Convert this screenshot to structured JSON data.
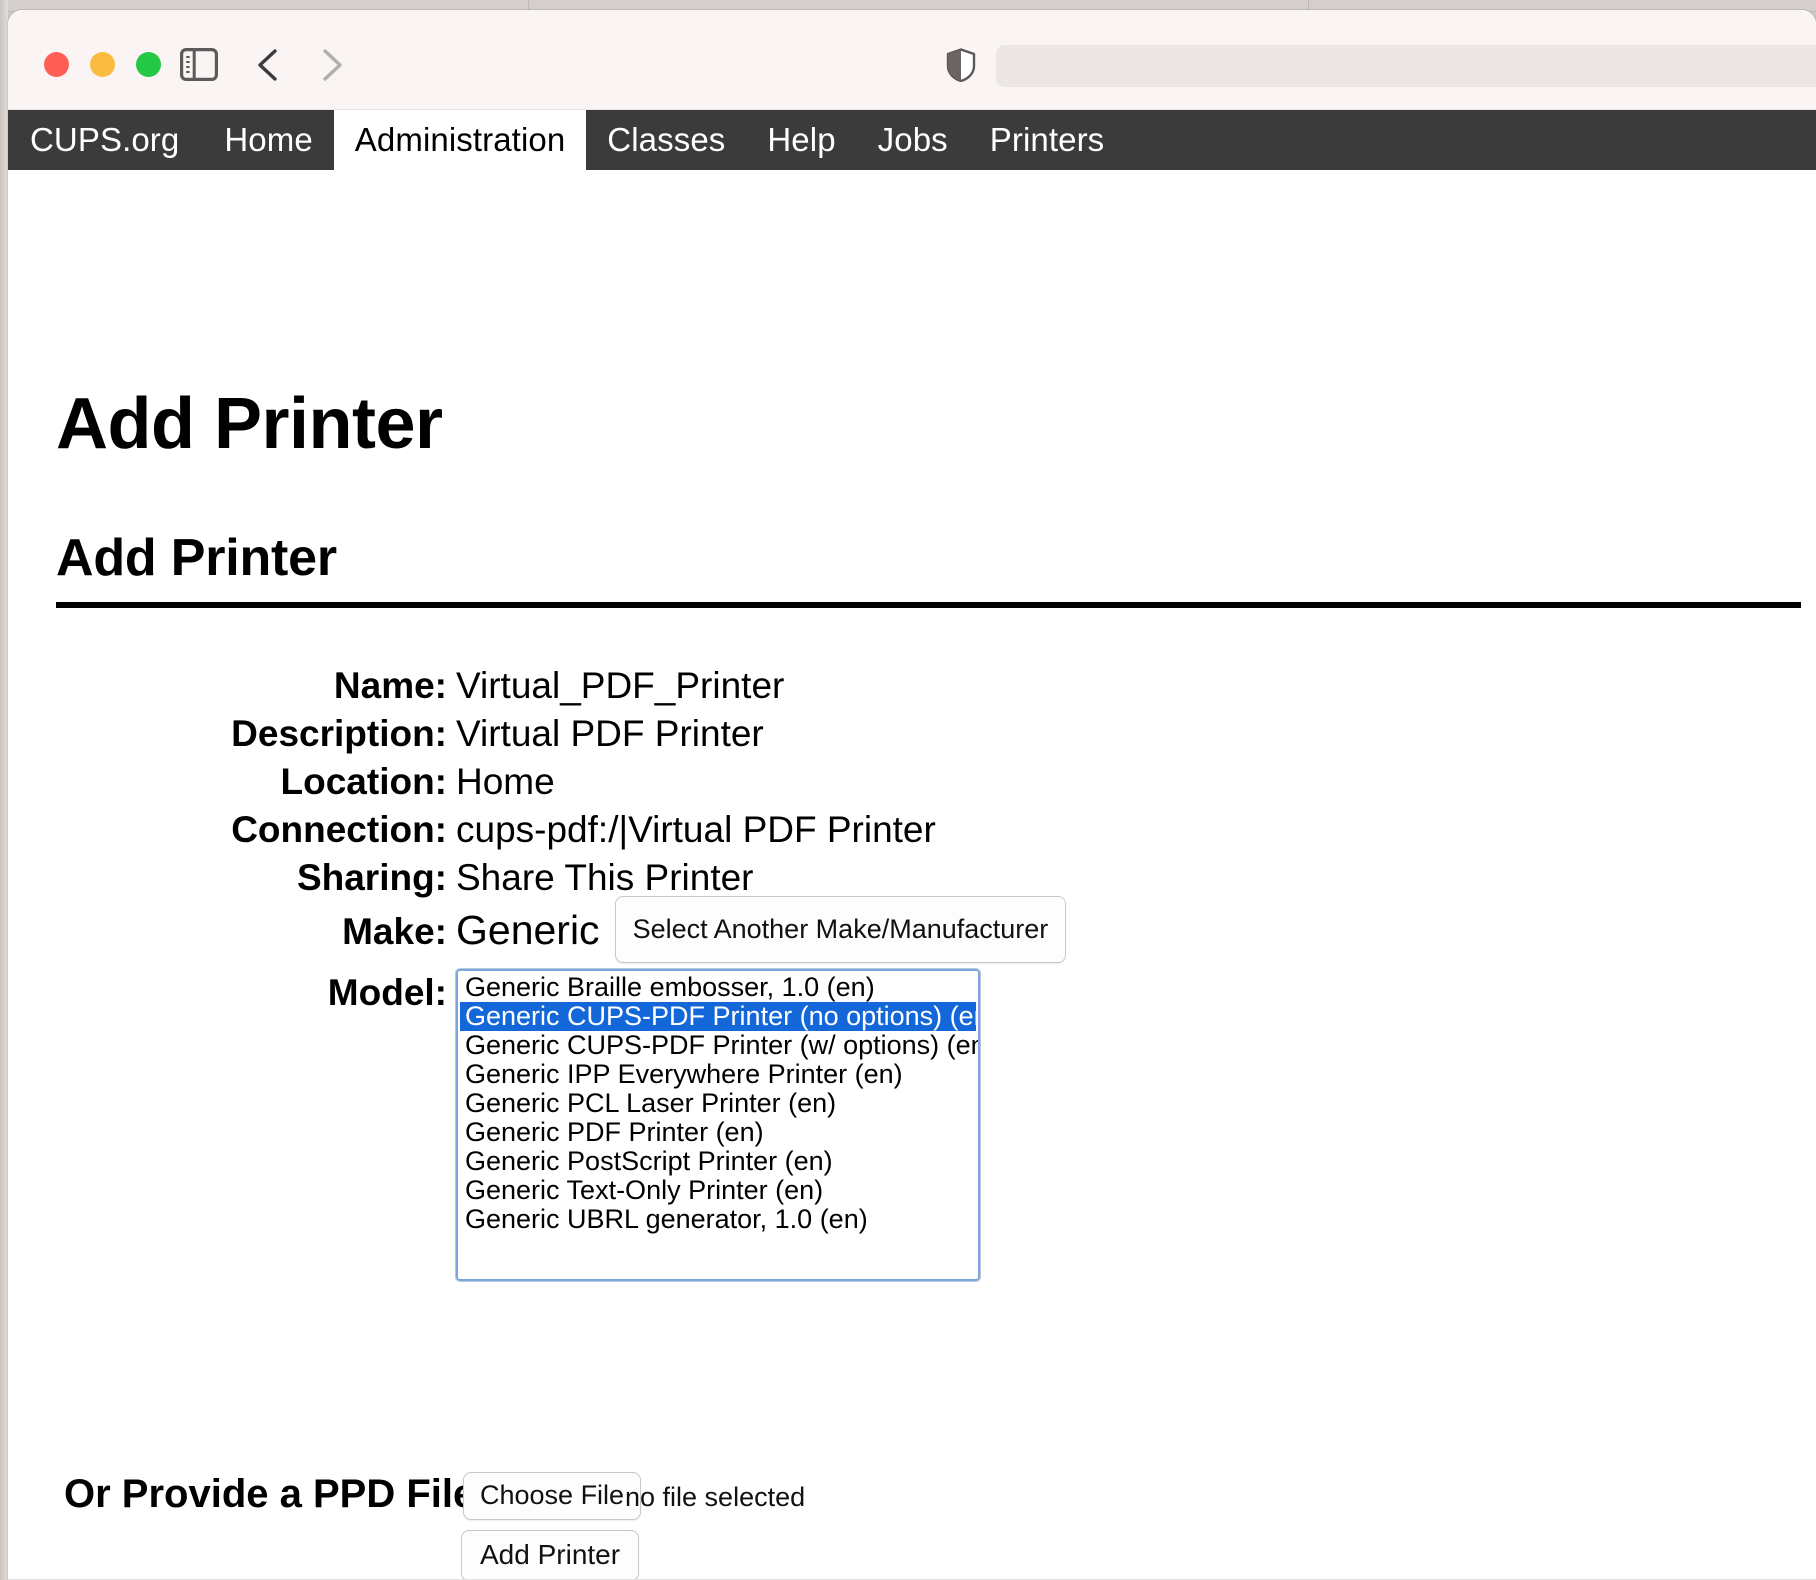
{
  "browser": {
    "window_controls": [
      "close",
      "minimize",
      "maximize"
    ],
    "sidebar_toggle_icon": "sidebar-icon",
    "back_icon": "chevron-left-icon",
    "forward_icon": "chevron-right-icon",
    "shield_icon": "privacy-shield-icon",
    "address_bar_value": "",
    "address_bar_placeholder": ""
  },
  "cups_nav": {
    "items": [
      {
        "label": "CUPS.org",
        "active": false
      },
      {
        "label": "Home",
        "active": false
      },
      {
        "label": "Administration",
        "active": true
      },
      {
        "label": "Classes",
        "active": false
      },
      {
        "label": "Help",
        "active": false
      },
      {
        "label": "Jobs",
        "active": false
      },
      {
        "label": "Printers",
        "active": false
      }
    ]
  },
  "page": {
    "title": "Add Printer",
    "section_heading": "Add Printer"
  },
  "form": {
    "rows": [
      {
        "label": "Name:",
        "value": "Virtual_PDF_Printer"
      },
      {
        "label": "Description:",
        "value": "Virtual PDF Printer"
      },
      {
        "label": "Location:",
        "value": "Home"
      },
      {
        "label": "Connection:",
        "value": "cups-pdf:/|Virtual PDF Printer"
      },
      {
        "label": "Sharing:",
        "value": "Share This Printer"
      }
    ],
    "make": {
      "label": "Make:",
      "value": "Generic",
      "button_label": "Select Another Make/Manufacturer"
    },
    "model": {
      "label": "Model:",
      "options": [
        {
          "label": "Generic Braille embosser, 1.0 (en)",
          "selected": false
        },
        {
          "label": "Generic CUPS-PDF Printer (no options) (en)",
          "selected": true
        },
        {
          "label": "Generic CUPS-PDF Printer (w/ options) (en)",
          "selected": false
        },
        {
          "label": "Generic IPP Everywhere Printer (en)",
          "selected": false
        },
        {
          "label": "Generic PCL Laser Printer (en)",
          "selected": false
        },
        {
          "label": "Generic PDF Printer (en)",
          "selected": false
        },
        {
          "label": "Generic PostScript Printer (en)",
          "selected": false
        },
        {
          "label": "Generic Text-Only Printer (en)",
          "selected": false
        },
        {
          "label": "Generic UBRL generator, 1.0 (en)",
          "selected": false
        }
      ],
      "selected_value": "Generic CUPS-PDF Printer (no options) (en)"
    },
    "ppd": {
      "label": "Or Provide a PPD File:",
      "choose_file_label": "Choose File",
      "file_status": "no file selected"
    },
    "submit_label": "Add Printer"
  },
  "colors": {
    "nav_background": "#3b3b3b",
    "nav_active_background": "#ffffff",
    "selection_blue": "#1367d9",
    "listbox_focus_border": "#7ba7e0",
    "toolbar_background": "#faf4f4",
    "traffic_close": "#ff5f57",
    "traffic_min": "#f9bc40",
    "traffic_max": "#23c844"
  }
}
